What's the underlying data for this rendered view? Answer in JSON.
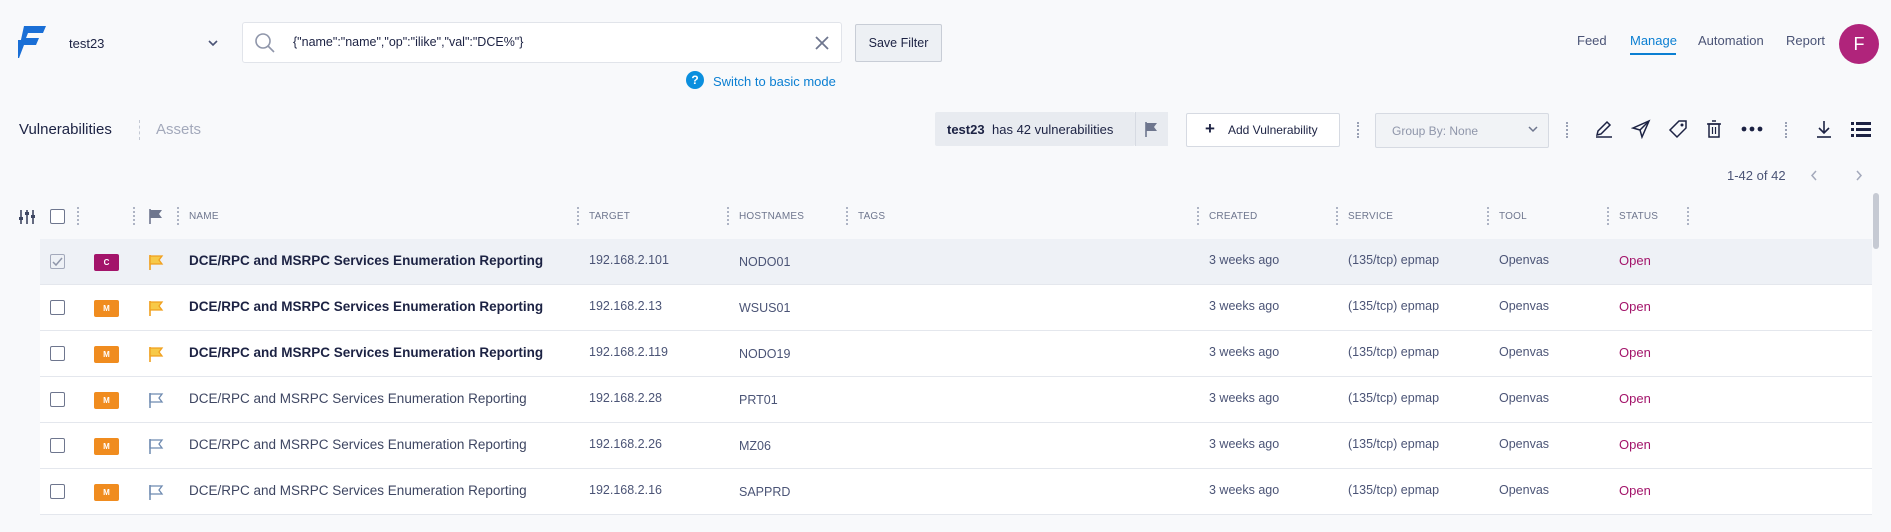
{
  "app": {
    "workspace": "test23",
    "filter_query": "{\"name\":\"name\",\"op\":\"ilike\",\"val\":\"DCE%\"}",
    "save_filter_label": "Save Filter",
    "basic_mode_label": "Switch to basic mode",
    "nav": {
      "feed": "Feed",
      "manage": "Manage",
      "automation": "Automation",
      "report": "Report"
    },
    "avatar_initial": "F",
    "colors": {
      "accent": "#0b7fd2",
      "avatar": "#b0247b",
      "critical": "#a3146a",
      "medium": "#f08c1f",
      "status_open": "#a3146a"
    }
  },
  "toolbar": {
    "tab_vulnerabilities": "Vulnerabilities",
    "tab_assets": "Assets",
    "count_workspace": "test23",
    "count_text": "has 42 vulnerabilities",
    "add_vulnerability": "Add Vulnerability",
    "group_by": "Group By: None",
    "icons": [
      "edit-icon",
      "send-icon",
      "tag-icon",
      "trash-icon",
      "more-icon",
      "download-icon",
      "list-icon"
    ]
  },
  "pagination": {
    "label": "1-42 of 42"
  },
  "table": {
    "headers": {
      "name": "NAME",
      "target": "TARGET",
      "hostnames": "HOSTNAMES",
      "tags": "TAGS",
      "created": "CREATED",
      "service": "SERVICE",
      "tool": "TOOL",
      "status": "STATUS"
    },
    "rows": [
      {
        "checked": true,
        "severity": "C",
        "flag": "orange",
        "bold": true,
        "name": "DCE/RPC and MSRPC Services Enumeration Reporting",
        "target": "192.168.2.101",
        "hostname": "NODO01",
        "created": "3 weeks ago",
        "service": "(135/tcp) epmap",
        "tool": "Openvas",
        "status": "Open"
      },
      {
        "checked": false,
        "severity": "M",
        "flag": "orange",
        "bold": true,
        "name": "DCE/RPC and MSRPC Services Enumeration Reporting",
        "target": "192.168.2.13",
        "hostname": "WSUS01",
        "created": "3 weeks ago",
        "service": "(135/tcp) epmap",
        "tool": "Openvas",
        "status": "Open"
      },
      {
        "checked": false,
        "severity": "M",
        "flag": "orange",
        "bold": true,
        "name": "DCE/RPC and MSRPC Services Enumeration Reporting",
        "target": "192.168.2.119",
        "hostname": "NODO19",
        "created": "3 weeks ago",
        "service": "(135/tcp) epmap",
        "tool": "Openvas",
        "status": "Open"
      },
      {
        "checked": false,
        "severity": "M",
        "flag": "outline",
        "bold": false,
        "name": "DCE/RPC and MSRPC Services Enumeration Reporting",
        "target": "192.168.2.28",
        "hostname": "PRT01",
        "created": "3 weeks ago",
        "service": "(135/tcp) epmap",
        "tool": "Openvas",
        "status": "Open"
      },
      {
        "checked": false,
        "severity": "M",
        "flag": "outline",
        "bold": false,
        "name": "DCE/RPC and MSRPC Services Enumeration Reporting",
        "target": "192.168.2.26",
        "hostname": "MZ06",
        "created": "3 weeks ago",
        "service": "(135/tcp) epmap",
        "tool": "Openvas",
        "status": "Open"
      },
      {
        "checked": false,
        "severity": "M",
        "flag": "outline",
        "bold": false,
        "name": "DCE/RPC and MSRPC Services Enumeration Reporting",
        "target": "192.168.2.16",
        "hostname": "SAPPRD",
        "created": "3 weeks ago",
        "service": "(135/tcp) epmap",
        "tool": "Openvas",
        "status": "Open"
      }
    ]
  }
}
